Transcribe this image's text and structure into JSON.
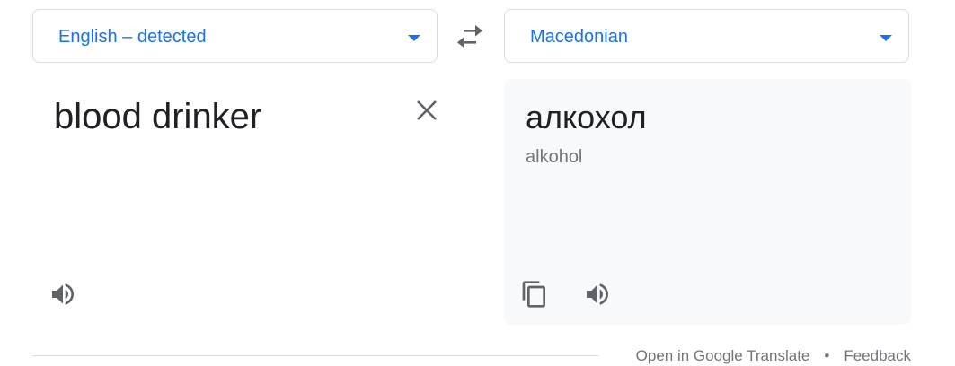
{
  "source_language": {
    "label": "English – detected"
  },
  "target_language": {
    "label": "Macedonian"
  },
  "source": {
    "text": "blood drinker"
  },
  "target": {
    "text": "алкохол",
    "transliteration": "alkohol"
  },
  "icons": {
    "swap": "swap-languages-icon",
    "clear": "close-icon",
    "source_listen": "volume-icon",
    "copy": "copy-icon",
    "target_listen": "volume-icon",
    "caret": "chevron-down-icon"
  },
  "footer": {
    "open_link": "Open in Google Translate",
    "separator": "•",
    "feedback": "Feedback"
  },
  "colors": {
    "accent": "#1a73e8",
    "icon_gray": "#5f6368",
    "panel_bg": "#f8f9fa",
    "border": "#dadce0"
  }
}
